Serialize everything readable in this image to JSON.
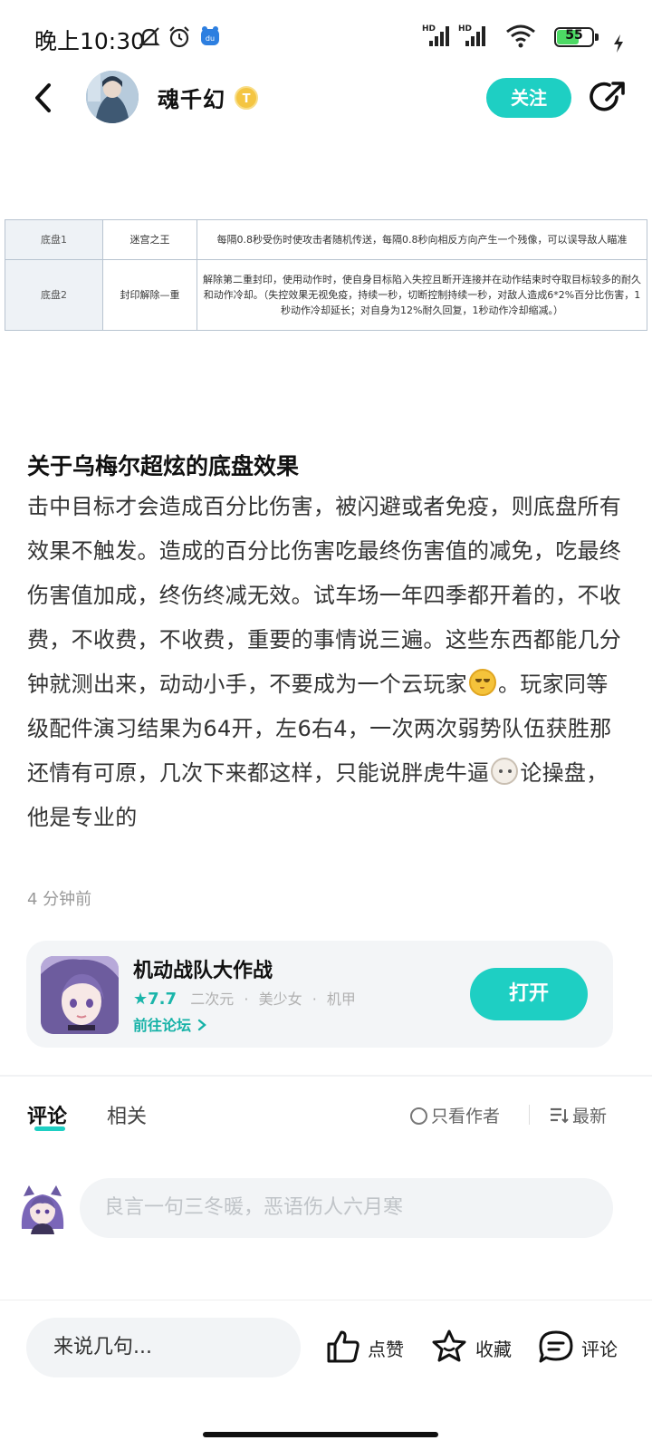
{
  "status_bar": {
    "time": "晚上10:30",
    "battery": "55",
    "icons": [
      "bell-off-icon",
      "alarm-icon",
      "app-notify-icon",
      "hd-signal-icon",
      "hd-signal-icon",
      "wifi-icon",
      "battery-icon",
      "charging-icon"
    ]
  },
  "header": {
    "author": "魂千幻",
    "level_badge": "T",
    "follow_label": "关注"
  },
  "table": {
    "rows": [
      {
        "slot": "底盘1",
        "name": "迷宫之王",
        "desc": "每隔0.8秒受伤时使攻击者随机传送，每隔0.8秒向相反方向产生一个残像，可以误导敌人瞄准"
      },
      {
        "slot": "底盘2",
        "name": "封印解除—重",
        "desc": "解除第二重封印，使用动作时，使自身目标陷入失控且断开连接并在动作结束时夺取目标较多的耐久和动作冷却。（失控效果无视免疫，持续一秒，切断控制持续一秒，对敌人造成6*2%百分比伤害，1秒动作冷却延长；对自身为12%耐久回复，1秒动作冷却缩减。）"
      }
    ]
  },
  "article": {
    "title": "关于乌梅尔超炫的底盘效果",
    "body_part1": "击中目标才会造成百分比伤害，被闪避或者免疫，则底盘所有效果不触发。造成的百分比伤害吃最终伤害值的减免，吃最终伤害值加成，终伤终减无效。试车场一年四季都开着的，不收费，不收费，不收费，重要的事情说三遍。这些东西都能几分钟就测出来，动动小手，不要成为一个云玩家",
    "body_part2": "。玩家同等级配件演习结果为64开，左6右4，一次两次弱势队伍获胜那还情有可原，几次下来都这样，只能说胖虎牛逼",
    "body_part3": "论操盘，他是专业的",
    "timestamp": "4 分钟前"
  },
  "game_card": {
    "name": "机动战队大作战",
    "rating": "★7.7",
    "tags": [
      "二次元",
      "美少女",
      "机甲"
    ],
    "forum_link": "前往论坛",
    "open_label": "打开"
  },
  "tabs": {
    "comment": "评论",
    "related": "相关",
    "author_only": "只看作者",
    "sort": "最新"
  },
  "comment_input": {
    "placeholder": "良言一句三冬暖，恶语伤人六月寒"
  },
  "bottom_bar": {
    "say_placeholder": "来说几句...",
    "like": "点赞",
    "favorite": "收藏",
    "comment": "评论"
  }
}
